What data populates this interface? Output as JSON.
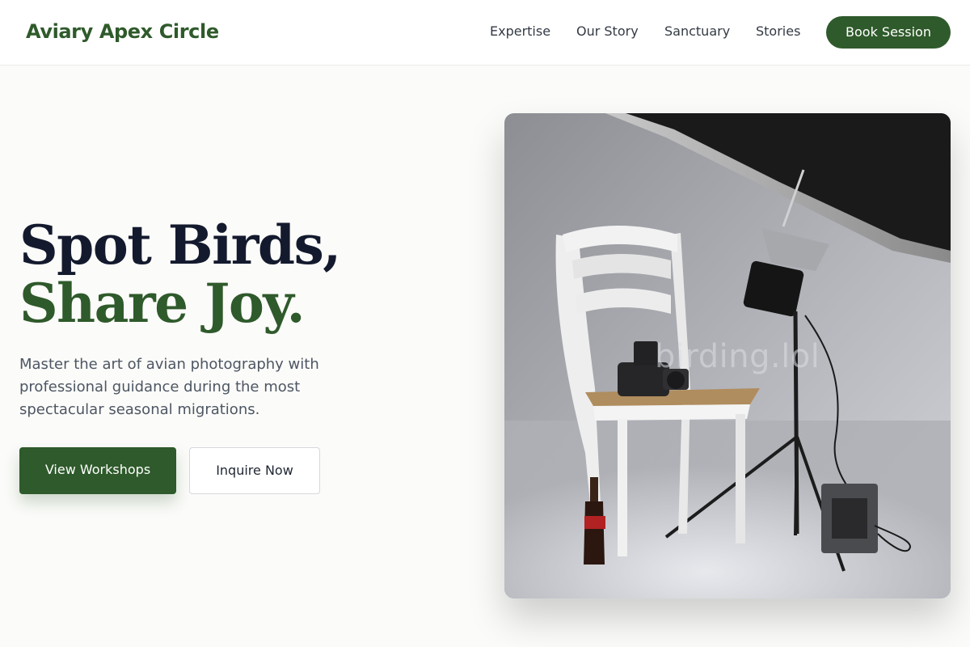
{
  "brand": {
    "name": "Aviary Apex Circle",
    "accent": "#2f5a2b"
  },
  "nav": {
    "links": [
      "Expertise",
      "Our Story",
      "Sanctuary",
      "Stories"
    ],
    "cta": "Book Session"
  },
  "hero": {
    "title_line1": "Spot Birds,",
    "title_line2": "Share Joy.",
    "description": "Master the art of avian photography with professional guidance during the most spectacular seasonal migrations.",
    "primary_button": "View Workshops",
    "secondary_button": "Inquire Now",
    "image": {
      "alt": "Photography studio setup with chair, camera, and lighting equipment",
      "watermark": "birding.lol"
    }
  }
}
